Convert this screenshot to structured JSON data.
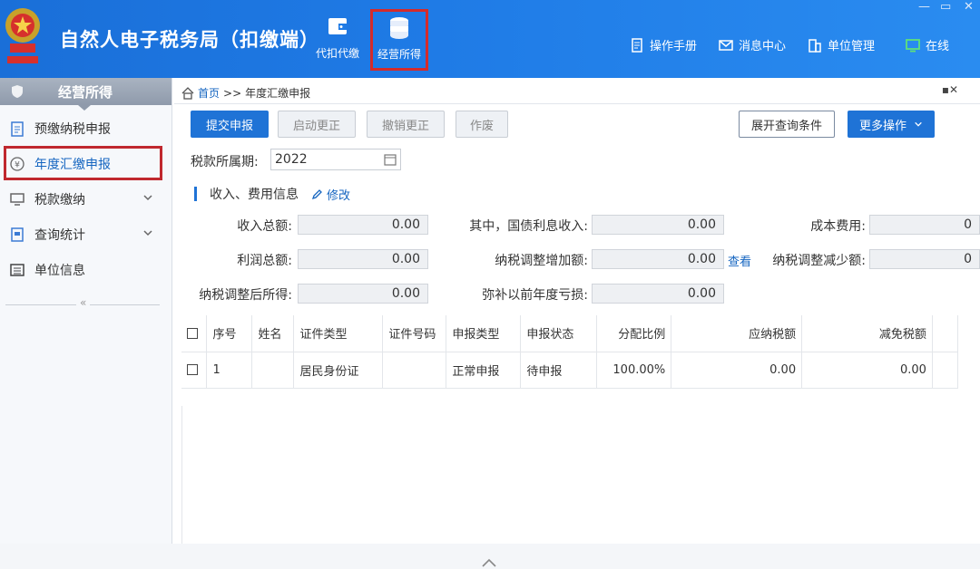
{
  "header": {
    "app_title": "自然人电子税务局（扣缴端）",
    "tabs": [
      {
        "label": "代扣代缴"
      },
      {
        "label": "经营所得"
      }
    ],
    "links": [
      {
        "label": "操作手册",
        "icon": "manual-icon"
      },
      {
        "label": "消息中心",
        "icon": "mail-icon"
      },
      {
        "label": "单位管理",
        "icon": "building-icon"
      },
      {
        "label": "在线",
        "icon": "online-icon"
      }
    ]
  },
  "sidebar": {
    "title": "经营所得",
    "items": [
      {
        "label": "预缴纳税申报",
        "icon": "clipboard-icon"
      },
      {
        "label": "年度汇缴申报",
        "icon": "yen-icon"
      },
      {
        "label": "税款缴纳",
        "icon": "payment-icon"
      },
      {
        "label": "查询统计",
        "icon": "query-icon"
      },
      {
        "label": "单位信息",
        "icon": "list-icon"
      }
    ],
    "collapse_glyph": "«"
  },
  "breadcrumb": {
    "home": "首页",
    "sep": ">>",
    "current": "年度汇缴申报"
  },
  "toolbar": {
    "submit": "提交申报",
    "start_correction": "启动更正",
    "cancel_correction": "撤销更正",
    "void": "作废",
    "expand_query": "展开查询条件",
    "more_ops": "更多操作"
  },
  "period": {
    "label": "税款所属期:",
    "value": "2022"
  },
  "section": {
    "title": "收入、费用信息",
    "edit_label": "修改"
  },
  "fields": {
    "total_income": {
      "label": "收入总额:",
      "value": "0.00"
    },
    "bond_interest": {
      "label": "其中，国债利息收入:",
      "value": "0.00"
    },
    "cost": {
      "label": "成本费用:",
      "value": "0"
    },
    "total_profit": {
      "label": "利润总额:",
      "value": "0.00"
    },
    "adj_increase": {
      "label": "纳税调整增加额:",
      "value": "0.00"
    },
    "view_link": "查看",
    "adj_decrease": {
      "label": "纳税调整减少额:",
      "value": "0"
    },
    "adjusted_income": {
      "label": "纳税调整后所得:",
      "value": "0.00"
    },
    "prior_loss": {
      "label": "弥补以前年度亏损:",
      "value": "0.00"
    }
  },
  "table": {
    "columns": [
      "序号",
      "姓名",
      "证件类型",
      "证件号码",
      "申报类型",
      "申报状态",
      "分配比例",
      "应纳税额",
      "减免税额"
    ],
    "rows": [
      {
        "seq": "1",
        "name": "",
        "id_type": "居民身份证",
        "id_no": "",
        "decl_type": "正常申报",
        "decl_status": "待申报",
        "ratio": "100.00%",
        "tax_payable": "0.00",
        "tax_relief": "0.00"
      }
    ]
  },
  "colors": {
    "header_blue": "#1f7be6",
    "primary_button": "#1f73d6",
    "highlight_red": "#c0282e",
    "link_blue": "#1565c0"
  }
}
